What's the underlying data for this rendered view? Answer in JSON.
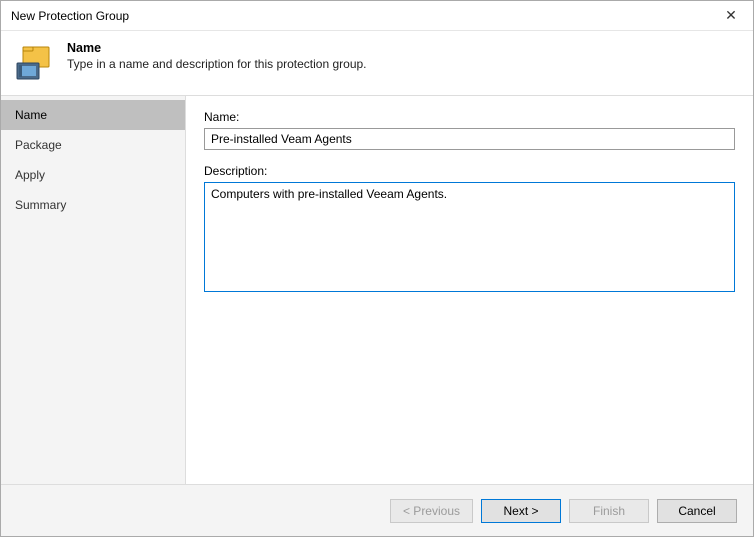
{
  "window": {
    "title": "New Protection Group",
    "close_label": "✕"
  },
  "header": {
    "heading": "Name",
    "subheading": "Type in a name and description for this protection group."
  },
  "sidebar": {
    "items": [
      {
        "label": "Name"
      },
      {
        "label": "Package"
      },
      {
        "label": "Apply"
      },
      {
        "label": "Summary"
      }
    ],
    "selected_index": 0
  },
  "form": {
    "name_label": "Name:",
    "name_value": "Pre-installed Veam Agents",
    "description_label": "Description:",
    "description_value": "Computers with pre-installed Veeam Agents."
  },
  "buttons": {
    "previous": "< Previous",
    "next": "Next >",
    "finish": "Finish",
    "cancel": "Cancel"
  }
}
